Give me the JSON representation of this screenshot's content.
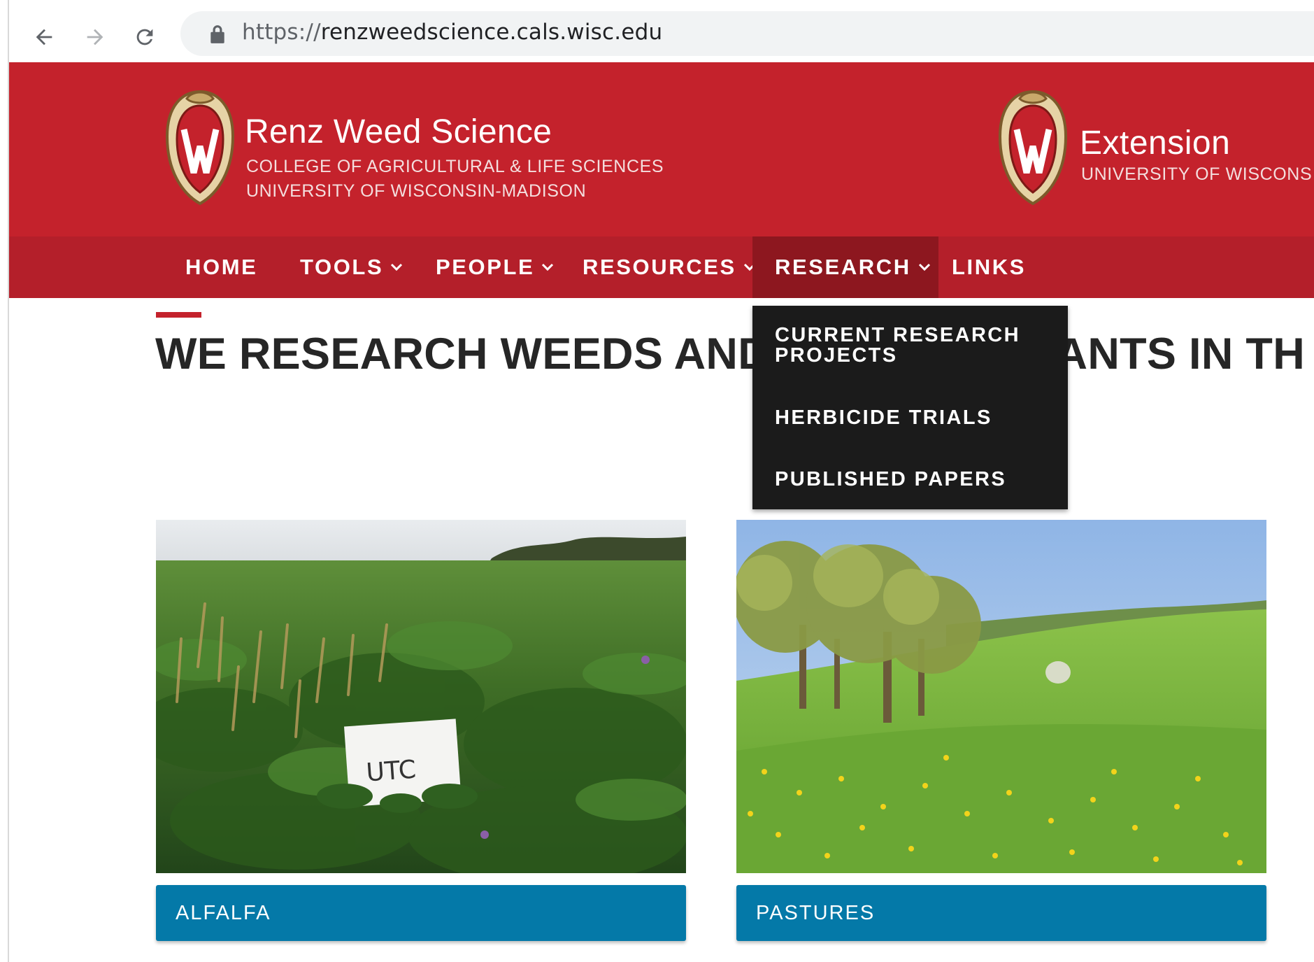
{
  "browser": {
    "url_protocol": "https://",
    "url_host": "renzweedscience.cals.wisc.edu",
    "icons": [
      "back-arrow-icon",
      "forward-arrow-icon",
      "reload-icon",
      "lock-icon"
    ]
  },
  "header": {
    "site_title": "Renz Weed Science",
    "college": "COLLEGE OF AGRICULTURAL & LIFE SCIENCES",
    "university": "UNIVERSITY OF WISCONSIN-MADISON",
    "extension_title": "Extension",
    "extension_sub": "UNIVERSITY OF WISCONS",
    "colors": {
      "header_red": "#c4222c",
      "nav_red": "#b41f2a",
      "active_nav": "#8d171f"
    }
  },
  "nav": {
    "home": "HOME",
    "tools": "TOOLS",
    "people": "PEOPLE",
    "resources": "RESOURCES",
    "research": "RESEARCH",
    "links": "LINKS",
    "active": "RESEARCH"
  },
  "research_menu": {
    "items": [
      "CURRENT RESEARCH PROJECTS",
      "HERBICIDE TRIALS",
      "PUBLISHED PAPERS"
    ]
  },
  "main": {
    "headline": "WE RESEARCH WEEDS AND INVASIVE PLANTS IN TH",
    "cards": [
      {
        "label": "ALFALFA",
        "photo_sign_text": "UTC"
      },
      {
        "label": "PASTURES"
      }
    ],
    "colors": {
      "card_blue": "#0479a8",
      "headline": "#262626"
    }
  }
}
